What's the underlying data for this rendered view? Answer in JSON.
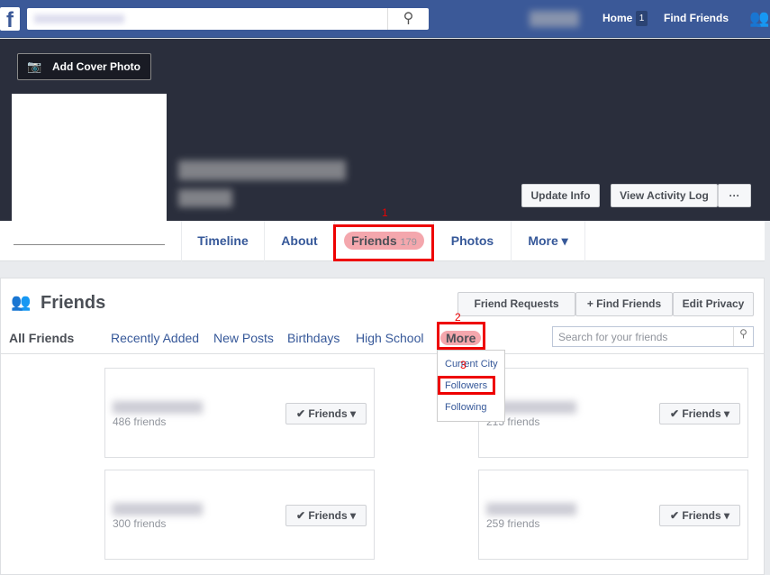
{
  "topbar": {
    "home": "Home",
    "home_badge": "1",
    "find_friends": "Find Friends"
  },
  "cover": {
    "add_cover": "Add Cover Photo",
    "update_info": "Update Info",
    "activity_log": "View Activity Log",
    "more": "···"
  },
  "tabs": {
    "timeline": "Timeline",
    "about": "About",
    "friends": "Friends",
    "friends_count": "179",
    "photos": "Photos",
    "more": "More ▾"
  },
  "annotations": [
    "1",
    "2",
    "3"
  ],
  "friends": {
    "title": "Friends",
    "friend_requests": "Friend Requests",
    "find_friends": "+ Find Friends",
    "edit_privacy": "Edit Privacy",
    "filters": [
      "All Friends",
      "Recently Added",
      "New Posts",
      "Birthdays",
      "High School",
      "More"
    ],
    "search_placeholder": "Search for your friends",
    "menu": [
      "Current City",
      "Followers",
      "Following"
    ],
    "cards": [
      {
        "count": "486 friends"
      },
      {
        "count": "215 friends"
      },
      {
        "count": "300 friends"
      },
      {
        "count": "259 friends"
      }
    ],
    "friend_button": "✔ Friends ▾"
  }
}
